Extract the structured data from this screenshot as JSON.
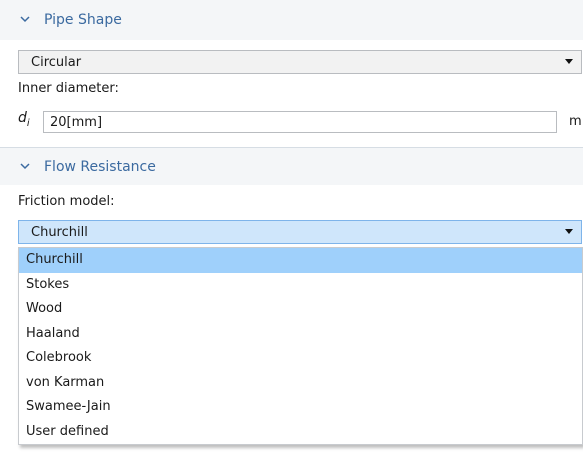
{
  "pipe_shape": {
    "section_title": "Pipe Shape",
    "shape_value": "Circular",
    "inner_diameter_label": "Inner diameter:",
    "diameter_symbol": "d",
    "diameter_subscript": "i",
    "diameter_value": "20[mm]",
    "diameter_unit": "m"
  },
  "flow_resistance": {
    "section_title": "Flow Resistance",
    "friction_label": "Friction model:",
    "friction_value": "Churchill",
    "options": [
      {
        "label": "Churchill",
        "selected": true
      },
      {
        "label": "Stokes",
        "selected": false
      },
      {
        "label": "Wood",
        "selected": false
      },
      {
        "label": "Haaland",
        "selected": false
      },
      {
        "label": "Colebrook",
        "selected": false
      },
      {
        "label": "von Karman",
        "selected": false
      },
      {
        "label": "Swamee-Jain",
        "selected": false
      },
      {
        "label": "User defined",
        "selected": false
      }
    ]
  },
  "colors": {
    "section_title": "#3b6aa0",
    "selected_option": "#9fd0fb",
    "open_select": "#cfe6fb"
  },
  "icons": {
    "section_toggle": "chevron-down-icon",
    "select_arrow": "caret-down-icon"
  }
}
